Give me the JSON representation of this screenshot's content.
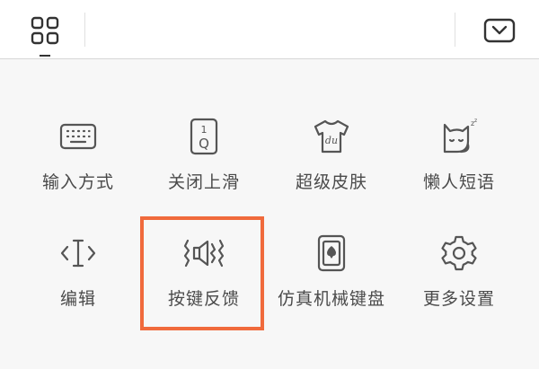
{
  "toolbar": {
    "menu_icon": "grid-four-squares-icon",
    "collapse_icon": "chevron-down-box-icon"
  },
  "colors": {
    "panel_bg": "#f7f7f7",
    "icon_stroke": "#555555",
    "highlight": "#f06a3c"
  },
  "grid": {
    "items": [
      {
        "label": "输入方式",
        "icon": "keyboard-icon"
      },
      {
        "label": "关闭上滑",
        "icon": "key-1q-icon"
      },
      {
        "label": "超级皮肤",
        "icon": "tshirt-du-icon"
      },
      {
        "label": "懒人短语",
        "icon": "sleeping-cat-icon"
      },
      {
        "label": "编辑",
        "icon": "text-cursor-icon"
      },
      {
        "label": "按键反馈",
        "icon": "speaker-vibrate-icon"
      },
      {
        "label": "仿真机械键盘",
        "icon": "mechanical-key-icon"
      },
      {
        "label": "更多设置",
        "icon": "gear-icon"
      }
    ],
    "highlighted": "按键反馈"
  }
}
